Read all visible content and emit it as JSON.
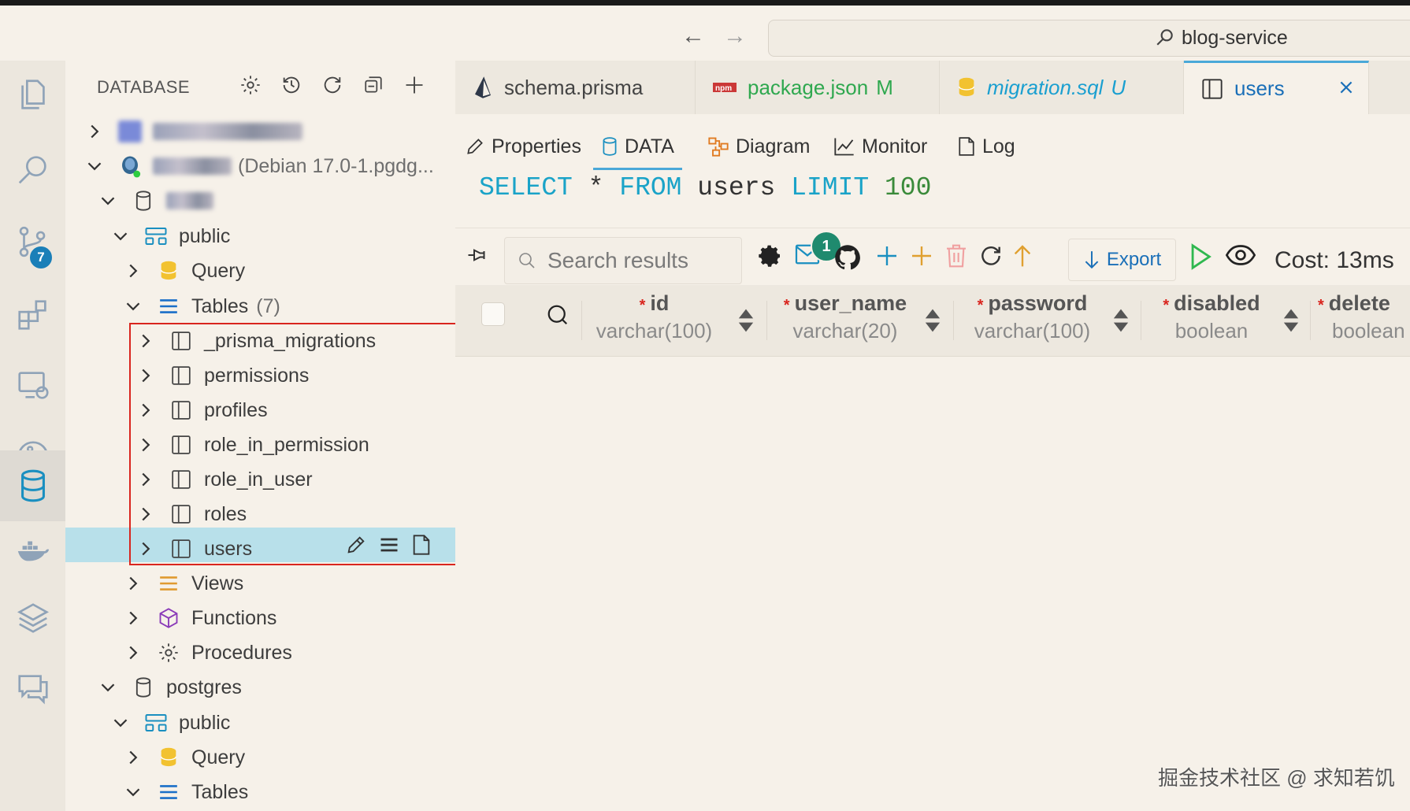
{
  "titlebar": {
    "command_center": "blog-service"
  },
  "activity_bar": {
    "scm_badge": "7"
  },
  "sidebar": {
    "header": "DATABASE",
    "connection2_suffix": "(Debian 17.0-1.pgdg...",
    "public1": "public",
    "query1": "Query",
    "tables1": "Tables",
    "tables1_count": "(7)",
    "tables": [
      "_prisma_migrations",
      "permissions",
      "profiles",
      "role_in_permission",
      "role_in_user",
      "roles",
      "users"
    ],
    "views": "Views",
    "functions": "Functions",
    "procedures": "Procedures",
    "postgres": "postgres",
    "public2": "public",
    "query2": "Query",
    "tables2": "Tables"
  },
  "tabs": [
    {
      "label": "schema.prisma",
      "suffix": ""
    },
    {
      "label": "package.json",
      "suffix": "M"
    },
    {
      "label": "migration.sql",
      "suffix": "U"
    },
    {
      "label": "users",
      "suffix": ""
    }
  ],
  "subtabs": [
    "Properties",
    "DATA",
    "Diagram",
    "Monitor",
    "Log"
  ],
  "sql": {
    "select": "SELECT",
    "star": "*",
    "from": "FROM",
    "table": "users",
    "limit": "LIMIT",
    "n": "100"
  },
  "toolbar": {
    "search_placeholder": "Search results",
    "notification_count": "1",
    "export": "Export",
    "cost": "Cost: 13ms"
  },
  "columns": [
    {
      "name": "id",
      "type": "varchar(100)"
    },
    {
      "name": "user_name",
      "type": "varchar(20)"
    },
    {
      "name": "password",
      "type": "varchar(100)"
    },
    {
      "name": "disabled",
      "type": "boolean"
    },
    {
      "name": "delete",
      "type": "boolean"
    }
  ],
  "watermark": "掘金技术社区 @ 求知若饥",
  "colors": {
    "accent": "#4aa8d8",
    "selection": "#b8e0ea",
    "highlight_box": "#d9251e",
    "modified": "#2fa84f",
    "untracked": "#1a9fd0"
  }
}
